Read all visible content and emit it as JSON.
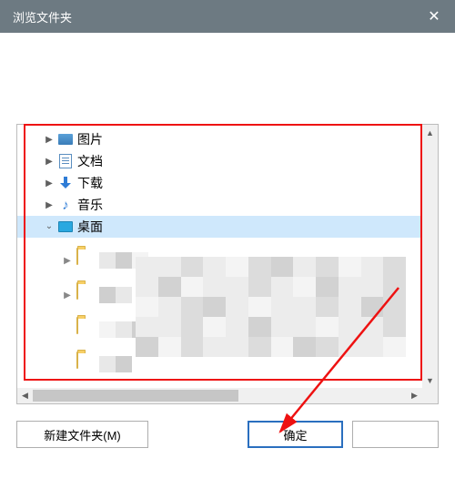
{
  "title": "浏览文件夹",
  "tree": {
    "items": [
      {
        "label": "图片",
        "icon": "pictures",
        "expandable": true
      },
      {
        "label": "文档",
        "icon": "documents",
        "expandable": true
      },
      {
        "label": "下载",
        "icon": "downloads",
        "expandable": true
      },
      {
        "label": "音乐",
        "icon": "music",
        "expandable": true
      },
      {
        "label": "桌面",
        "icon": "desktop",
        "expandable": true,
        "expanded": true,
        "selected": true
      }
    ]
  },
  "buttons": {
    "new_folder": "新建文件夹(M)",
    "ok": "确定",
    "cancel": ""
  }
}
